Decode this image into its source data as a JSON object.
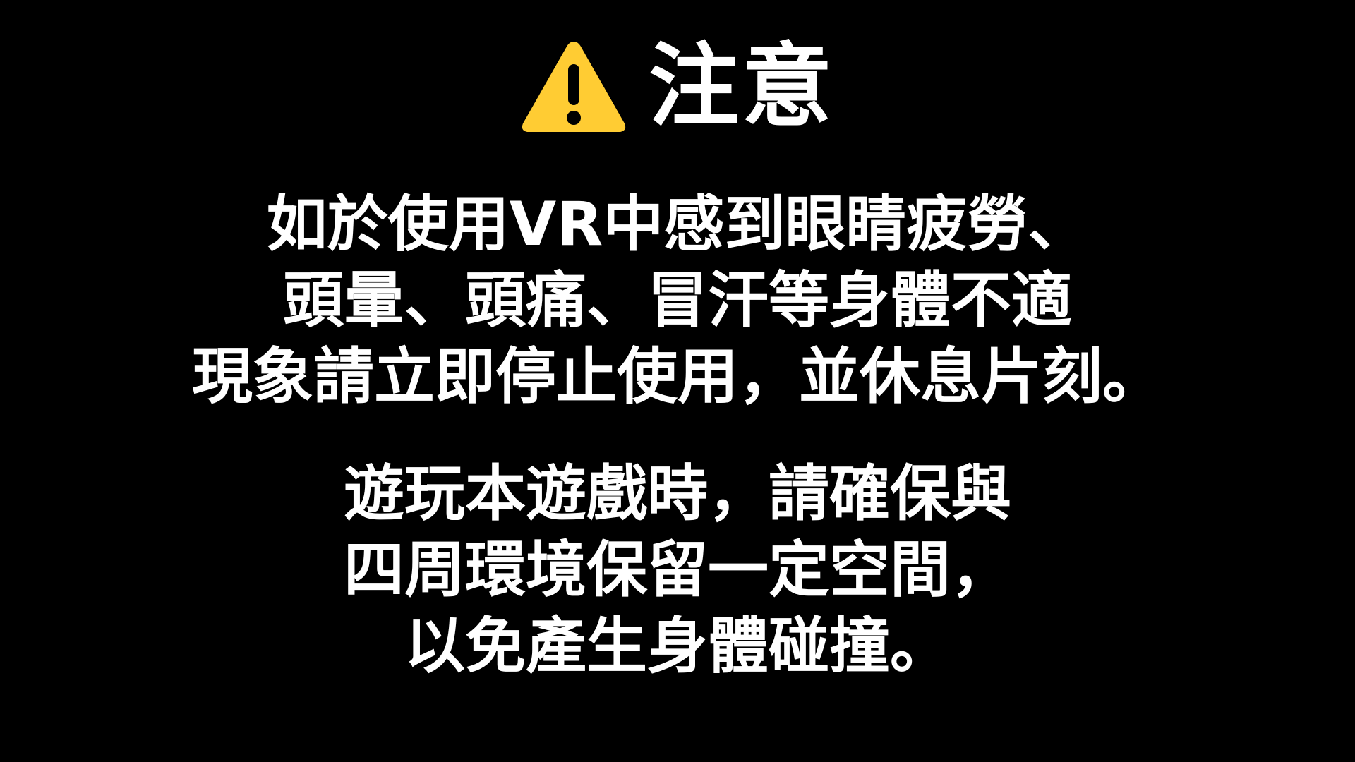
{
  "notice": {
    "icon": "warning-icon",
    "title": "注意",
    "paragraphs": [
      {
        "lines": [
          "如於使用VR中感到眼睛疲勞、",
          "頭暈、頭痛、冒汗等身體不適",
          "現象請立即停止使用，並休息片刻。"
        ]
      },
      {
        "lines": [
          "遊玩本遊戲時，請確保與",
          "四周環境保留一定空間，",
          "以免產生身體碰撞。"
        ]
      }
    ]
  },
  "colors": {
    "background": "#000000",
    "text": "#ffffff",
    "warning_fill": "#FFCC33",
    "warning_glyph": "#000000"
  }
}
